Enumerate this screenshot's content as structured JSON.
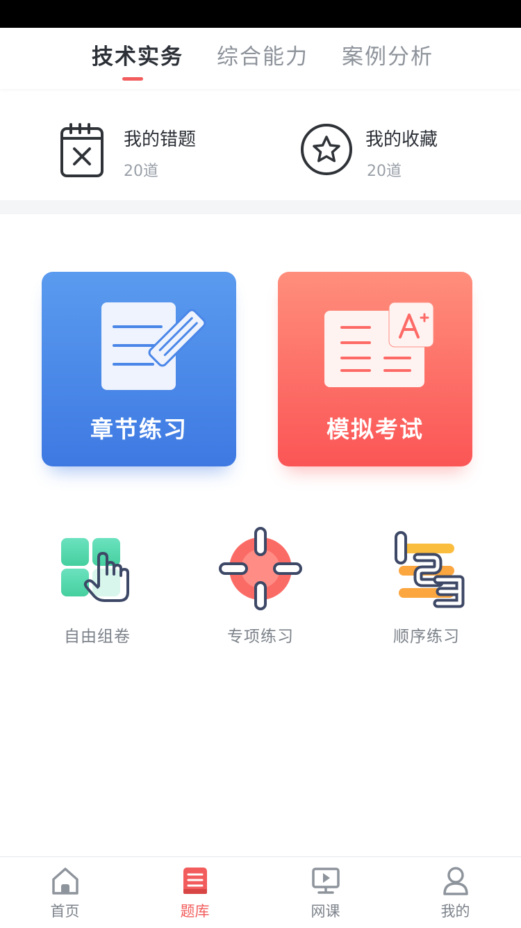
{
  "tabs": [
    {
      "label": "技术实务",
      "active": true
    },
    {
      "label": "综合能力",
      "active": false
    },
    {
      "label": "案例分析",
      "active": false
    }
  ],
  "stats": {
    "wrong": {
      "title": "我的错题",
      "count": "20道",
      "icon": "calendar-x-icon"
    },
    "favorites": {
      "title": "我的收藏",
      "count": "20道",
      "icon": "star-icon"
    }
  },
  "cards": {
    "chapter": {
      "label": "章节练习",
      "icon": "document-pen-icon",
      "color": "#4a86e8"
    },
    "mock": {
      "label": "模拟考试",
      "icon": "exam-paper-icon",
      "color": "#fd6a66"
    }
  },
  "features": [
    {
      "label": "自由组卷",
      "icon": "grid-hand-icon"
    },
    {
      "label": "专项练习",
      "icon": "target-icon"
    },
    {
      "label": "顺序练习",
      "icon": "numbers-123-icon"
    }
  ],
  "nav": [
    {
      "label": "首页",
      "icon": "home-icon",
      "active": false
    },
    {
      "label": "题库",
      "icon": "question-bank-icon",
      "active": true
    },
    {
      "label": "网课",
      "icon": "video-lesson-icon",
      "active": false
    },
    {
      "label": "我的",
      "icon": "profile-icon",
      "active": false
    }
  ],
  "colors": {
    "accent": "#f25c5c",
    "blue": "#4a86e8",
    "red": "#fd6a66",
    "text": "#2b2f36",
    "muted": "#9aa0a8"
  }
}
